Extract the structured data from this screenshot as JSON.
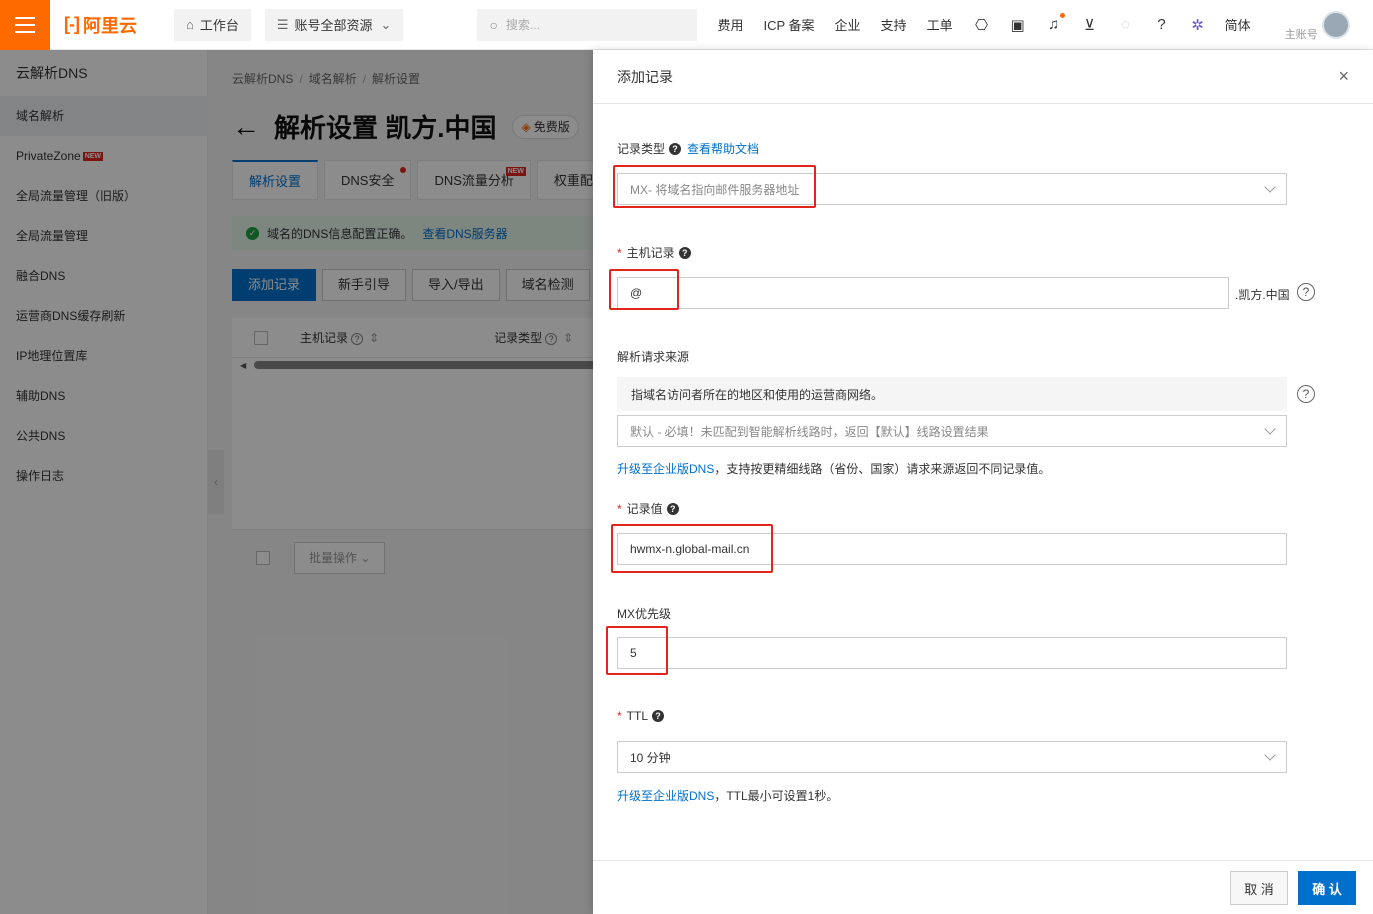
{
  "topbar": {
    "logo_text": "阿里云",
    "workbench": "工作台",
    "resources": "账号全部资源",
    "search_placeholder": "搜索...",
    "nav": [
      "费用",
      "ICP 备案",
      "企业",
      "支持",
      "工单"
    ],
    "lang": "简体",
    "account_label": "主账号"
  },
  "sidebar": {
    "title": "云解析DNS",
    "items": [
      {
        "label": "域名解析",
        "active": true
      },
      {
        "label": "PrivateZone",
        "badge": "NEW"
      },
      {
        "label": "全局流量管理（旧版）"
      },
      {
        "label": "全局流量管理"
      },
      {
        "label": "融合DNS"
      },
      {
        "label": "运营商DNS缓存刷新"
      },
      {
        "label": "IP地理位置库"
      },
      {
        "label": "辅助DNS"
      },
      {
        "label": "公共DNS"
      },
      {
        "label": "操作日志"
      }
    ]
  },
  "main": {
    "breadcrumb": [
      "云解析DNS",
      "域名解析",
      "解析设置"
    ],
    "title": "解析设置 凯方.中国",
    "edition_badge": "免费版",
    "tabs": [
      {
        "label": "解析设置",
        "active": true
      },
      {
        "label": "DNS安全",
        "dot": true
      },
      {
        "label": "DNS流量分析",
        "badge": "NEW"
      },
      {
        "label": "权重配置"
      }
    ],
    "notice": "域名的DNS信息配置正确。",
    "notice_link": "查看DNS服务器",
    "actions": [
      "添加记录",
      "新手引导",
      "导入/导出",
      "域名检测"
    ],
    "columns": [
      "主机记录",
      "记录类型"
    ],
    "batch_label": "批量操作"
  },
  "drawer": {
    "title": "添加记录",
    "record_type": {
      "label": "记录类型",
      "help_link": "查看帮助文档",
      "value": "MX- 将域名指向邮件服务器地址"
    },
    "host": {
      "label": "主机记录",
      "value": "@",
      "suffix": ".凯方.中国"
    },
    "source": {
      "label": "解析请求来源",
      "hint": "指域名访问者所在的地区和使用的运营商网络。",
      "value": "默认 - 必填！未匹配到智能解析线路时，返回【默认】线路设置结果",
      "upgrade_link": "升级至企业版DNS",
      "upgrade_text": "，支持按更精细线路（省份、国家）请求来源返回不同记录值。"
    },
    "record_value": {
      "label": "记录值",
      "value": "hwmx-n.global-mail.cn"
    },
    "mx_priority": {
      "label": "MX优先级",
      "value": "5"
    },
    "ttl": {
      "label": "TTL",
      "value": "10 分钟",
      "upgrade_link": "升级至企业版DNS",
      "upgrade_text": "，TTL最小可设置1秒。"
    },
    "cancel": "取 消",
    "confirm": "确 认"
  }
}
